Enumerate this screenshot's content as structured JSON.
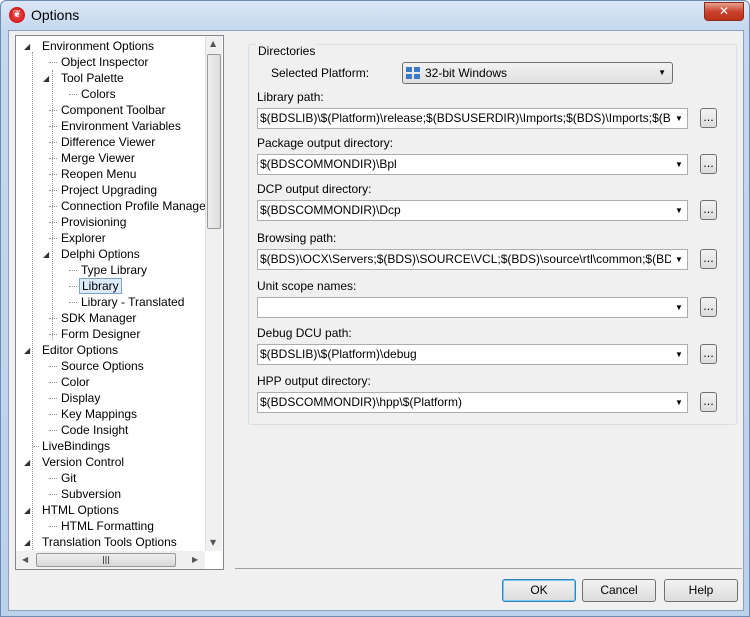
{
  "window": {
    "title": "Options",
    "close_label": "✕"
  },
  "tree": {
    "items": [
      {
        "label": "Environment Options",
        "level": 0,
        "expanded": true
      },
      {
        "label": "Object Inspector",
        "level": 1
      },
      {
        "label": "Tool Palette",
        "level": 1,
        "expanded": true
      },
      {
        "label": "Colors",
        "level": 2
      },
      {
        "label": "Component Toolbar",
        "level": 1
      },
      {
        "label": "Environment Variables",
        "level": 1
      },
      {
        "label": "Difference Viewer",
        "level": 1
      },
      {
        "label": "Merge Viewer",
        "level": 1
      },
      {
        "label": "Reopen Menu",
        "level": 1
      },
      {
        "label": "Project Upgrading",
        "level": 1
      },
      {
        "label": "Connection Profile Manager",
        "level": 1
      },
      {
        "label": "Provisioning",
        "level": 1
      },
      {
        "label": "Explorer",
        "level": 1
      },
      {
        "label": "Delphi Options",
        "level": 1,
        "expanded": true
      },
      {
        "label": "Type Library",
        "level": 2
      },
      {
        "label": "Library",
        "level": 2,
        "selected": true
      },
      {
        "label": "Library - Translated",
        "level": 2
      },
      {
        "label": "SDK Manager",
        "level": 1
      },
      {
        "label": "Form Designer",
        "level": 1
      },
      {
        "label": "Editor Options",
        "level": 0,
        "expanded": true
      },
      {
        "label": "Source Options",
        "level": 1
      },
      {
        "label": "Color",
        "level": 1
      },
      {
        "label": "Display",
        "level": 1
      },
      {
        "label": "Key Mappings",
        "level": 1
      },
      {
        "label": "Code Insight",
        "level": 1
      },
      {
        "label": "LiveBindings",
        "level": 0
      },
      {
        "label": "Version Control",
        "level": 0,
        "expanded": true
      },
      {
        "label": "Git",
        "level": 1
      },
      {
        "label": "Subversion",
        "level": 1
      },
      {
        "label": "HTML Options",
        "level": 0,
        "expanded": true
      },
      {
        "label": "HTML Formatting",
        "level": 1
      },
      {
        "label": "Translation Tools Options",
        "level": 0,
        "expanded": true
      }
    ]
  },
  "directories": {
    "group_label": "Directories",
    "platform_label": "Selected Platform:",
    "platform_value": "32-bit Windows",
    "fields": [
      {
        "label": "Library path:",
        "value": "$(BDSLIB)\\$(Platform)\\release;$(BDSUSERDIR)\\Imports;$(BDS)\\Imports;$(BDSCOMM"
      },
      {
        "label": "Package output directory:",
        "value": "$(BDSCOMMONDIR)\\Bpl"
      },
      {
        "label": "DCP output directory:",
        "value": "$(BDSCOMMONDIR)\\Dcp"
      },
      {
        "label": "Browsing path:",
        "value": "$(BDS)\\OCX\\Servers;$(BDS)\\SOURCE\\VCL;$(BDS)\\source\\rtl\\common;$(BDS)\\SOURC"
      },
      {
        "label": "Unit scope names:",
        "value": ""
      },
      {
        "label": "Debug DCU path:",
        "value": "$(BDSLIB)\\$(Platform)\\debug"
      },
      {
        "label": "HPP output directory:",
        "value": "$(BDSCOMMONDIR)\\hpp\\$(Platform)"
      }
    ],
    "browse_label": "..."
  },
  "buttons": {
    "ok": "OK",
    "cancel": "Cancel",
    "help": "Help"
  },
  "colors": {
    "selection": "#dcebfc",
    "title_bar": "#c4d7ee",
    "close": "#c8432c"
  }
}
